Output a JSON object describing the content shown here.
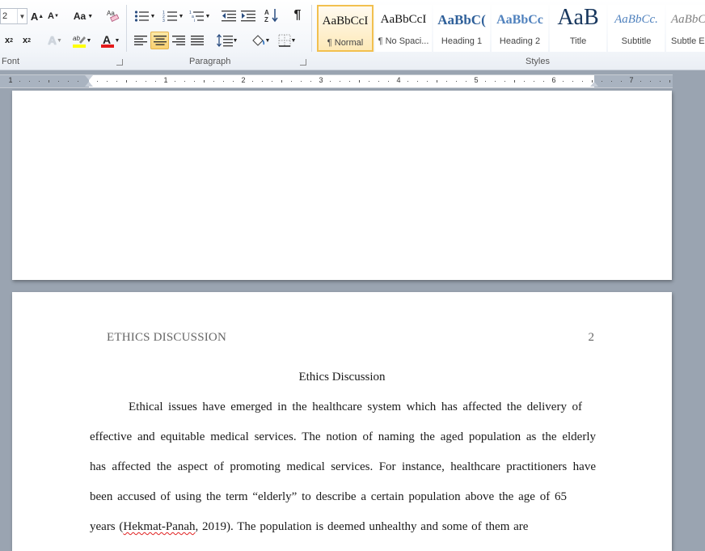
{
  "ribbon": {
    "font_size_value": "2",
    "change_case_label": "Aa",
    "groups": {
      "font": "Font",
      "paragraph": "Paragraph",
      "styles": "Styles"
    },
    "styles": [
      {
        "sample": "AaBbCcI",
        "name": "¶ Normal",
        "selected": true
      },
      {
        "sample": "AaBbCcI",
        "name": "¶ No Spaci..."
      },
      {
        "sample": "AaBbC(",
        "name": "Heading 1"
      },
      {
        "sample": "AaBbCc",
        "name": "Heading 2"
      },
      {
        "sample": "AaB",
        "name": "Title"
      },
      {
        "sample": "AaBbCc.",
        "name": "Subtitle"
      },
      {
        "sample": "AaBbCc",
        "name": "Subtle E"
      }
    ]
  },
  "ruler": {
    "numbers": [
      "1",
      "1",
      "2",
      "3",
      "4",
      "5",
      "6",
      "7"
    ]
  },
  "document": {
    "page2": {
      "header_left": "ETHICS DISCUSSION",
      "page_number": "2",
      "title": "Ethics Discussion",
      "lines": [
        "Ethical issues have emerged in the healthcare system which has affected the delivery of",
        "effective and equitable medical services. The notion of naming the aged population as the elderly",
        "has affected the aspect of promoting medical services. For instance, healthcare practitioners have",
        "been accused of using the term “elderly” to describe a certain population above the age of 65"
      ],
      "last_line_before": "years (",
      "last_line_citation": "Hekmat-Panah",
      "last_line_after": ", 2019). The population is deemed unhealthy and some of them are"
    }
  },
  "colors": {
    "ribbon_bg": "#f3f6fa",
    "workspace_bg": "#9aa4b1",
    "selected_style_border": "#f2c04f",
    "heading_blue": "#2e5f99",
    "title_navy": "#17365d"
  }
}
